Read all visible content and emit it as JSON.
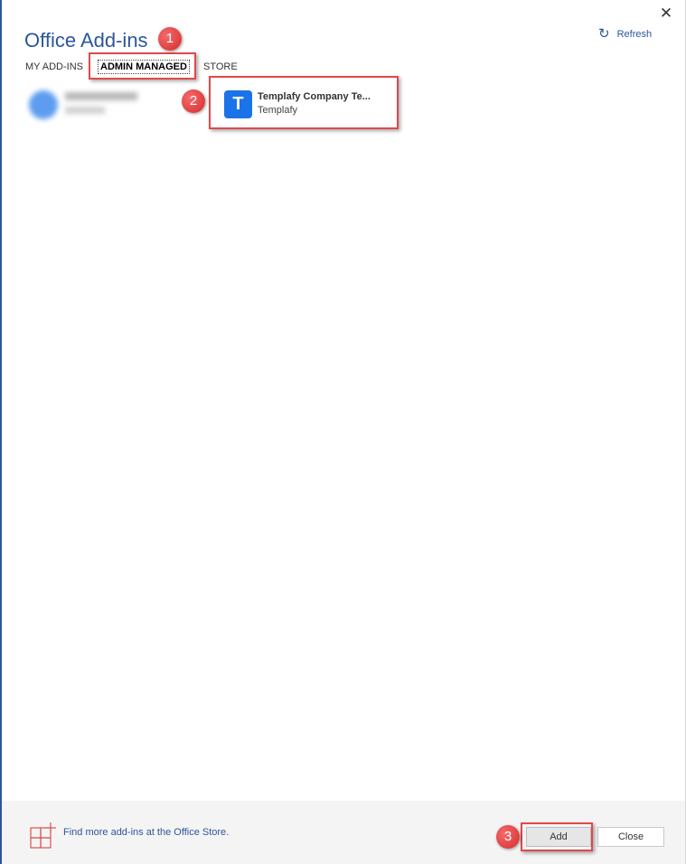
{
  "window": {
    "title": "Office Add-ins",
    "close_symbol": "✕"
  },
  "refresh": {
    "icon": "refresh-icon",
    "label": "Refresh"
  },
  "tabs": [
    {
      "label": "MY ADD-INS",
      "active": false
    },
    {
      "label": "ADMIN MANAGED",
      "active": true
    },
    {
      "label": "STORE",
      "active": false
    }
  ],
  "addins": [
    {
      "name": "Templafy Company Te...",
      "publisher": "Templafy",
      "icon_letter": "T",
      "icon_color": "#1a73e8"
    }
  ],
  "footer": {
    "store_link": "Find more add-ins at the Office Store.",
    "add_label": "Add",
    "close_label": "Close"
  },
  "callouts": [
    "1",
    "2",
    "3"
  ],
  "colors": {
    "accent": "#2b579a",
    "callout": "#e0494a",
    "store_icon": "#d9534f"
  }
}
